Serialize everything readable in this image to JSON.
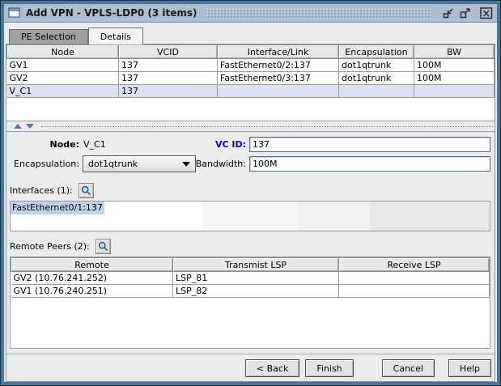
{
  "window": {
    "title": "Add VPN - VPLS-LDP0 (3 items)"
  },
  "tabs": [
    {
      "label": "PE Selection",
      "active": false
    },
    {
      "label": "Details",
      "active": true
    }
  ],
  "pe_table": {
    "columns": [
      "Node",
      "VCID",
      "Interface/Link",
      "Encapsulation",
      "BW"
    ],
    "rows": [
      [
        "GV1",
        "137",
        "FastEthernet0/2:137",
        "dot1qtrunk",
        "100M"
      ],
      [
        "GV2",
        "137",
        "FastEthernet0/3:137",
        "dot1qtrunk",
        "100M"
      ],
      [
        "V_C1",
        "137",
        "",
        "",
        ""
      ]
    ],
    "selected_row": 2
  },
  "details": {
    "node_label": "Node:",
    "node_value": "V_C1",
    "vcid_label": "VC ID:",
    "vcid_value": "137",
    "encapsulation_label": "Encapsulation:",
    "encapsulation_value": "dot1qtrunk",
    "bandwidth_label": "Bandwidth:",
    "bandwidth_value": "100M",
    "interfaces_label": "Interfaces (1):",
    "interfaces_items": [
      "FastEthernet0/1:137"
    ],
    "interfaces_selected_index": 0,
    "remote_peers_label": "Remote Peers (2):",
    "peers_table": {
      "columns": [
        "Remote",
        "Transmist LSP",
        "Receive LSP"
      ],
      "rows": [
        [
          "GV2 (10.76.241.252)",
          "LSP_81",
          ""
        ],
        [
          "GV1 (10.76.240.251)",
          "LSP_82",
          ""
        ]
      ]
    }
  },
  "buttons": {
    "back": "< Back",
    "finish": "Finish",
    "cancel": "Cancel",
    "help": "Help"
  },
  "colors": {
    "titlebar": "#adbecf",
    "frame": "#4d7396",
    "selection_row": "#dbe1ef",
    "list_selection": "#bfd4ea",
    "label_blue": "#0000cc"
  }
}
